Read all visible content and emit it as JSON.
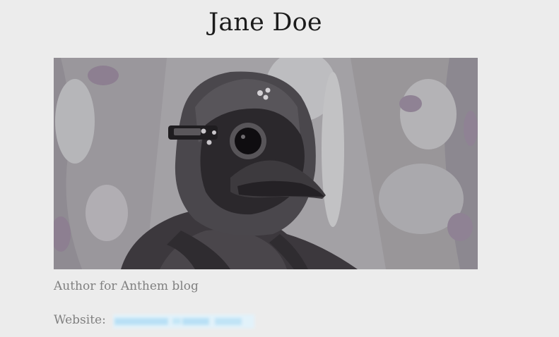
{
  "author": {
    "name": "Jane Doe",
    "bio": "Author for Anthem blog",
    "website_label": "Website:"
  },
  "photo": {
    "subject": "person-in-plague-doctor-mask"
  },
  "colors": {
    "background": "#ececec",
    "heading": "#1b1b1b",
    "muted_text": "#808080",
    "link_blur": "#cfe9f7"
  }
}
